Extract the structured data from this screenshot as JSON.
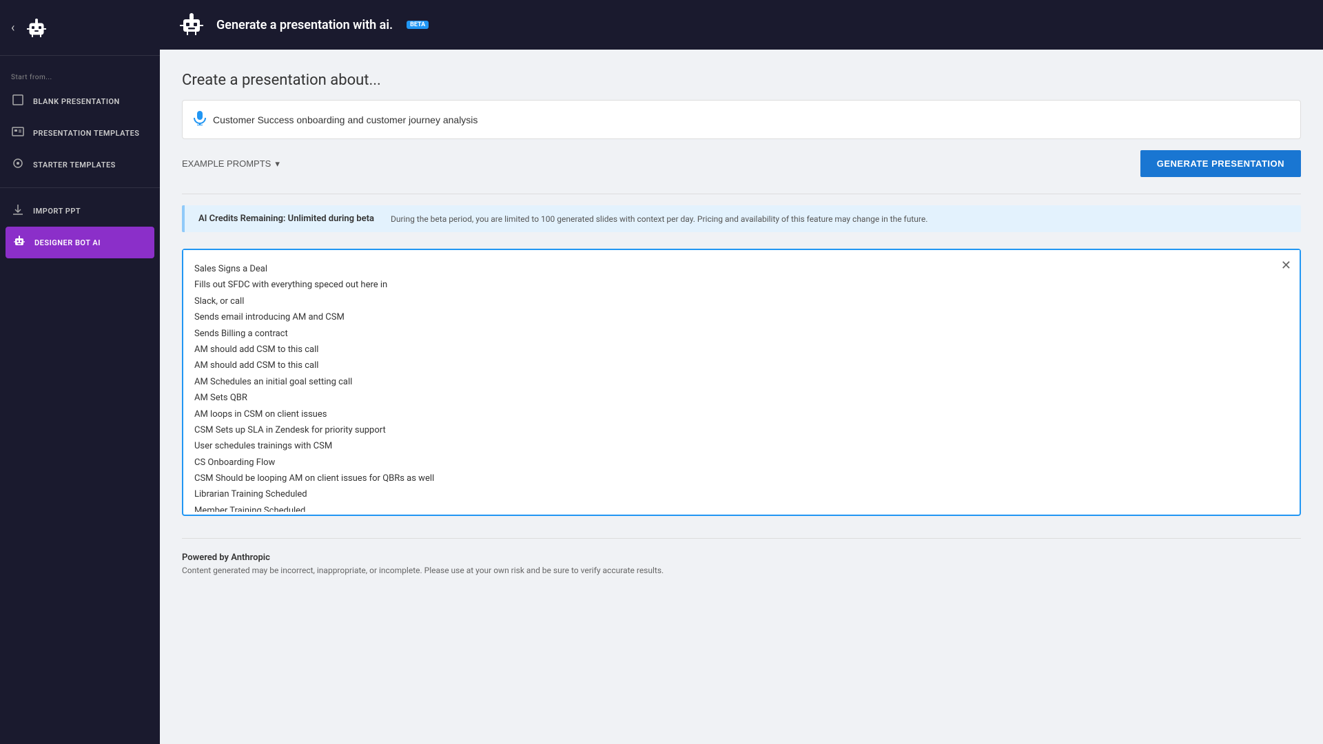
{
  "sidebar": {
    "back_icon": "‹",
    "app_title": "Generate a presentation with ai.",
    "beta_label": "BETA",
    "start_from_label": "Start from...",
    "items": [
      {
        "id": "blank-presentation",
        "label": "BLANK PRESENTATION",
        "icon": "⬜"
      },
      {
        "id": "presentation-templates",
        "label": "PRESENTATION TEMPLATES",
        "icon": "🖥"
      },
      {
        "id": "starter-templates",
        "label": "STARTER TEMPLATES",
        "icon": "💡"
      },
      {
        "id": "import-ppt",
        "label": "IMPORT PPT",
        "icon": "⇅"
      }
    ],
    "active_item": {
      "id": "designer-bot-ai",
      "label": "DESIGNER BOT AI",
      "icon": "🤖"
    }
  },
  "main": {
    "header_title": "Generate a presentation with ai.",
    "beta_badge": "BETA",
    "section_heading": "Create a presentation about...",
    "prompt_input_value": "Customer Success onboarding and customer journey analysis",
    "prompt_placeholder": "Customer Success onboarding and customer journey analysis",
    "example_prompts_label": "EXAMPLE PROMPTS",
    "generate_btn_label": "GENERATE PRESENTATION",
    "credits_label": "AI Credits Remaining: Unlimited during beta",
    "credits_desc": "During the beta period, you are limited to 100 generated slides with context per day. Pricing and availability of this feature may change in the future.",
    "textarea_content": "Sales Signs a Deal\nFills out SFDC with everything speced out here in\nSlack, or call\nSends email introducing AM and CSM\nSends Billing a contract\nAM should add CSM to this call\nAM should add CSM to this call\nAM Schedules an initial goal setting call\nAM Sets QBR\nAM loops in CSM on client issues\nCSM Sets up SLA in Zendesk for priority support\nUser schedules trainings with CSM\nCS Onboarding Flow\nCSM Should be looping AM on client issues for QBRs as well\nLibrarian Training Scheduled\nMember Training Scheduled\nSupport Call Set up",
    "close_icon": "✕",
    "powered_by_label": "Powered by Anthropic",
    "disclaimer": "Content generated may be incorrect, inappropriate, or incomplete. Please use at your own risk and be sure to verify accurate results."
  }
}
